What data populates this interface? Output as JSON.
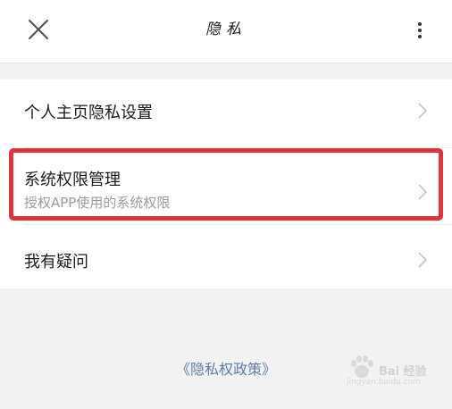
{
  "header": {
    "title": "隐私",
    "close_icon": "close-icon",
    "more_icon": "more-vertical-icon"
  },
  "rows": [
    {
      "label": "个人主页隐私设置",
      "icon": "chevron-right-icon"
    },
    {
      "label": "系统权限管理",
      "subtitle": "授权APP使用的系统权限",
      "icon": "chevron-right-icon",
      "highlighted": true
    },
    {
      "label": "我有疑问",
      "icon": "chevron-right-icon"
    }
  ],
  "footer": {
    "policy_link": "《隐私权政策》"
  },
  "watermark": {
    "text": "Bai 经验",
    "sub": "jingyan.baidu.com"
  },
  "colors": {
    "highlight": "#e0343d",
    "link": "#5a7ea6",
    "background": "#f2f2f2"
  }
}
